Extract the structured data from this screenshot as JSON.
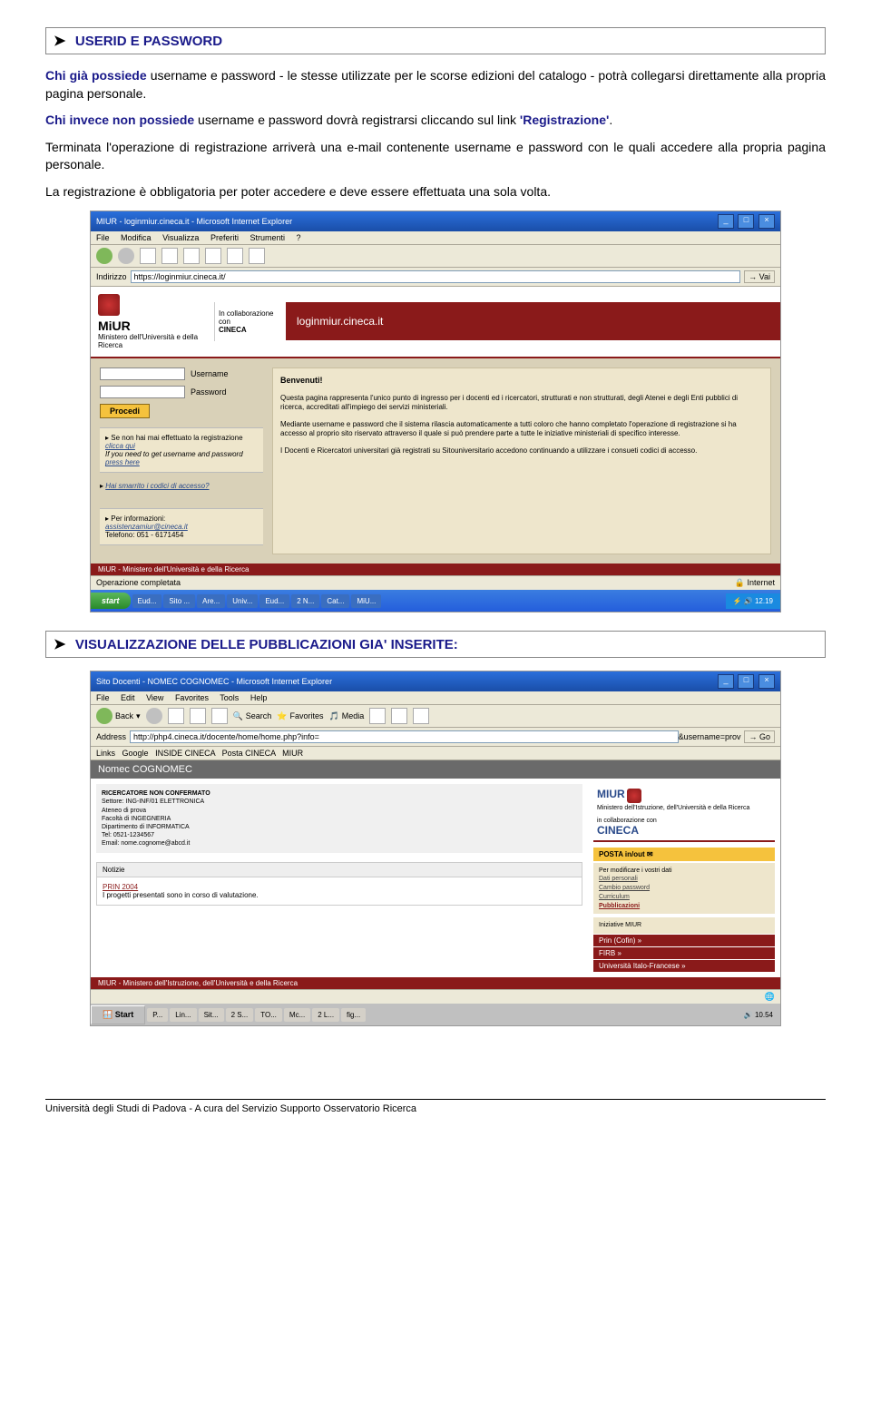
{
  "section1": {
    "heading": "USERID E PASSWORD",
    "p1_a": "Chi già possiede",
    "p1_b": " username e password - le stesse utilizzate per le scorse edizioni del catalogo - potrà collegarsi direttamente alla propria pagina personale.",
    "p2_a": "Chi invece non possiede",
    "p2_b": " username e password dovrà registrarsi cliccando sul link ",
    "p2_c": "'Registrazione'",
    "p2_d": ".",
    "p3": "Terminata l'operazione di registrazione arriverà una e-mail contenente username e password con le quali accedere alla propria pagina personale.",
    "p4": "La registrazione è obbligatoria per poter accedere e deve essere effettuata una sola volta."
  },
  "shot1": {
    "title": "MIUR - loginmiur.cineca.it - Microsoft Internet Explorer",
    "menu": [
      "File",
      "Modifica",
      "Visualizza",
      "Preferiti",
      "Strumenti",
      "?"
    ],
    "addr_label": "Indirizzo",
    "addr_value": "https://loginmiur.cineca.it/",
    "vai": "Vai",
    "logo_name": "MiUR",
    "logo_sub": "Ministero dell'Università e della Ricerca",
    "collab": "In collaborazione con",
    "cineca": "CINECA",
    "page_title": "loginmiur.cineca.it",
    "username_label": "Username",
    "password_label": "Password",
    "procedi": "Procedi",
    "reg_note1": "Se non hai mai effettuato la registrazione ",
    "reg_link1": "clicca qui",
    "reg_note2": "If you need to get username and password ",
    "reg_link2": "press here",
    "lost_link": "Hai smarrito i codici di accesso?",
    "info_label": "Per informazioni:",
    "info_email": "assistenzamiur@cineca.it",
    "info_tel": "Telefono: 051 - 6171454",
    "benvenuti_h": "Benvenuti!",
    "benvenuti_p1": "Questa pagina rappresenta l'unico punto di ingresso per i docenti ed i ricercatori, strutturati e non strutturati, degli Atenei e degli Enti pubblici di ricerca, accreditati all'impiego dei servizi ministeriali.",
    "benvenuti_p2": "Mediante username e password che il sistema rilascia automaticamente a tutti coloro che hanno completato l'operazione di registrazione si ha accesso al proprio sito riservato attraverso il quale si può prendere parte a tutte le iniziative ministeriali di specifico interesse.",
    "benvenuti_p3": "I Docenti e Ricercatori universitari già registrati su Sitouniversitario accedono continuando a utilizzare i consueti codici di accesso.",
    "footer": "MiUR - Ministero dell'Università e della Ricerca",
    "status": "Operazione completata",
    "status_zone": "Internet",
    "start": "start",
    "tasks": [
      "Eud...",
      "Sito ...",
      "Are...",
      "Univ...",
      "Eud...",
      "2 N...",
      "Cat...",
      "MiU..."
    ],
    "time": "12.19"
  },
  "section2": {
    "heading": "VISUALIZZAZIONE DELLE PUBBLICAZIONI GIA' INSERITE:"
  },
  "shot2": {
    "title": "Sito Docenti - NOMEC COGNOMEC - Microsoft Internet Explorer",
    "menu": [
      "File",
      "Edit",
      "View",
      "Favorites",
      "Tools",
      "Help"
    ],
    "back": "Back",
    "search": "Search",
    "favorites": "Favorites",
    "media": "Media",
    "addr_label": "Address",
    "addr_value": "http://php4.cineca.it/docente/home/home.php?info=",
    "addr_tail": "&username=prov",
    "go": "Go",
    "links_label": "Links",
    "links": [
      "Google",
      "INSIDE CINECA",
      "Posta CINECA",
      "MIUR"
    ],
    "name": "Nomec COGNOMEC",
    "role": "RICERCATORE NON CONFERMATO",
    "settore": "Settore: ING-INF/01 ELETTRONICA",
    "ateneo": "Ateneo di prova",
    "facolta": "Facoltà di INGEGNERIA",
    "dip": "Dipartimento di INFORMATICA",
    "tel": "Tel: 0521-1234567",
    "email": "Email: nome.cognome@abcd.it",
    "notizie_h": "Notizie",
    "prin_link": "PRIN 2004",
    "prin_txt": "I progetti presentati sono in corso di valutazione.",
    "right_logo": "MIUR",
    "right_sub": "Ministero dell'Istruzione, dell'Università e della Ricerca",
    "right_collab": "in collaborazione con",
    "right_cineca": "CINECA",
    "posta": "POSTA in/out",
    "mod_label": "Per modificare i vostri dati",
    "side_items": [
      "Dati personali",
      "Cambio password",
      "Curriculum",
      "Pubblicazioni"
    ],
    "init_label": "Iniziative MIUR",
    "init_items": [
      "Prin (Cofin) »",
      "FIRB »",
      "Università Italo-Francese »"
    ],
    "footer": "MIUR - Ministero dell'Istruzione, dell'Università e della Ricerca",
    "status": "",
    "start": "Start",
    "tasks": [
      "P...",
      "Lin...",
      "Sit...",
      "2 S...",
      "TO...",
      "Mc...",
      "2 L...",
      "fig..."
    ],
    "time": "10.54"
  },
  "page_footer": "Università degli Studi di Padova - A cura del Servizio Supporto Osservatorio Ricerca"
}
